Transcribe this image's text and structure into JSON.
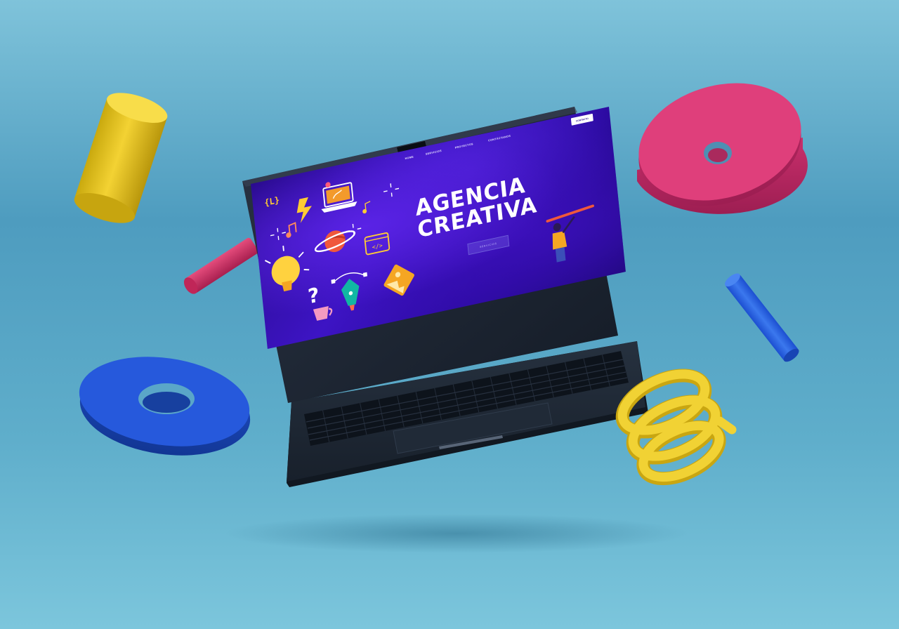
{
  "scene": {
    "background_colors": [
      "#7fc3da",
      "#4e9cbf",
      "#5faecb",
      "#7cc6dc"
    ],
    "floating_objects": [
      "yellow-cylinder",
      "pink-disc",
      "red-rod",
      "blue-rod",
      "blue-disc",
      "yellow-spring"
    ]
  },
  "laptop": {
    "body_color": "#1e2836",
    "website": {
      "logo": "{L}",
      "nav": [
        "HOME",
        "SERVICIOS",
        "PROYECTOS",
        "CONTÁCTANOS",
        "CONTACTO"
      ],
      "hero_title_line1": "AGENCIA",
      "hero_title_line2": "CREATIVA",
      "cta_label": "SERVICIOS",
      "colors": {
        "primary": "#3d14c4",
        "accent_yellow": "#ffcc33",
        "accent_orange": "#f39a2b",
        "title": "#ffffff"
      },
      "icons": [
        "curly-brace-logo",
        "lightning-icon",
        "laptop-heart-icon",
        "music-note-icon",
        "planet-icon",
        "lightbulb-icon",
        "code-icon",
        "question-icon",
        "coffee-cup-icon",
        "pen-tool-icon",
        "image-icon",
        "painter-figure"
      ]
    }
  }
}
